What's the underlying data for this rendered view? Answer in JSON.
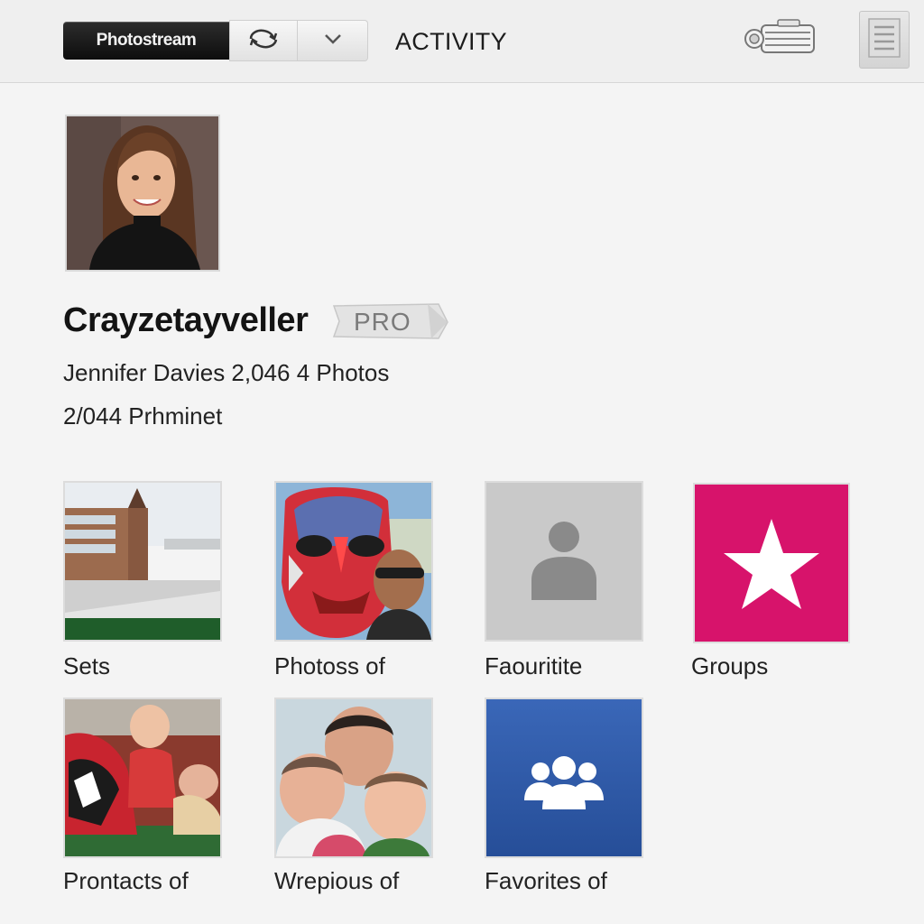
{
  "topbar": {
    "photostream_label": "Photostream",
    "activity_label": "ACTIVITY",
    "sync_icon": "sync-icon",
    "dropdown_icon": "chevron-down-icon",
    "camera_icon": "camera-icon",
    "menu_icon": "menu-icon"
  },
  "profile": {
    "username": "Crayzetayveller",
    "badge": "PRO",
    "name_line": "Jennifer Davies 2,046 4 Photos",
    "secondary_line": "2/044 Prhminet"
  },
  "tiles": [
    {
      "label": "Sets",
      "kind": "photo-building"
    },
    {
      "label": "Photoss of",
      "kind": "photo-mask"
    },
    {
      "label": "Faouritite",
      "kind": "person-placeholder",
      "color": "#c9c9c9"
    },
    {
      "label": "Groups",
      "kind": "star",
      "color": "#d7136b"
    },
    {
      "label": "Prontacts of",
      "kind": "photo-baby"
    },
    {
      "label": "Wrepious of",
      "kind": "photo-family"
    },
    {
      "label": "Favorites of",
      "kind": "group-icon",
      "color": "#2e5aa8"
    }
  ],
  "colors": {
    "accent_pink": "#d7136b",
    "accent_blue": "#2e5aa8",
    "topbar_bg": "#efefef"
  }
}
